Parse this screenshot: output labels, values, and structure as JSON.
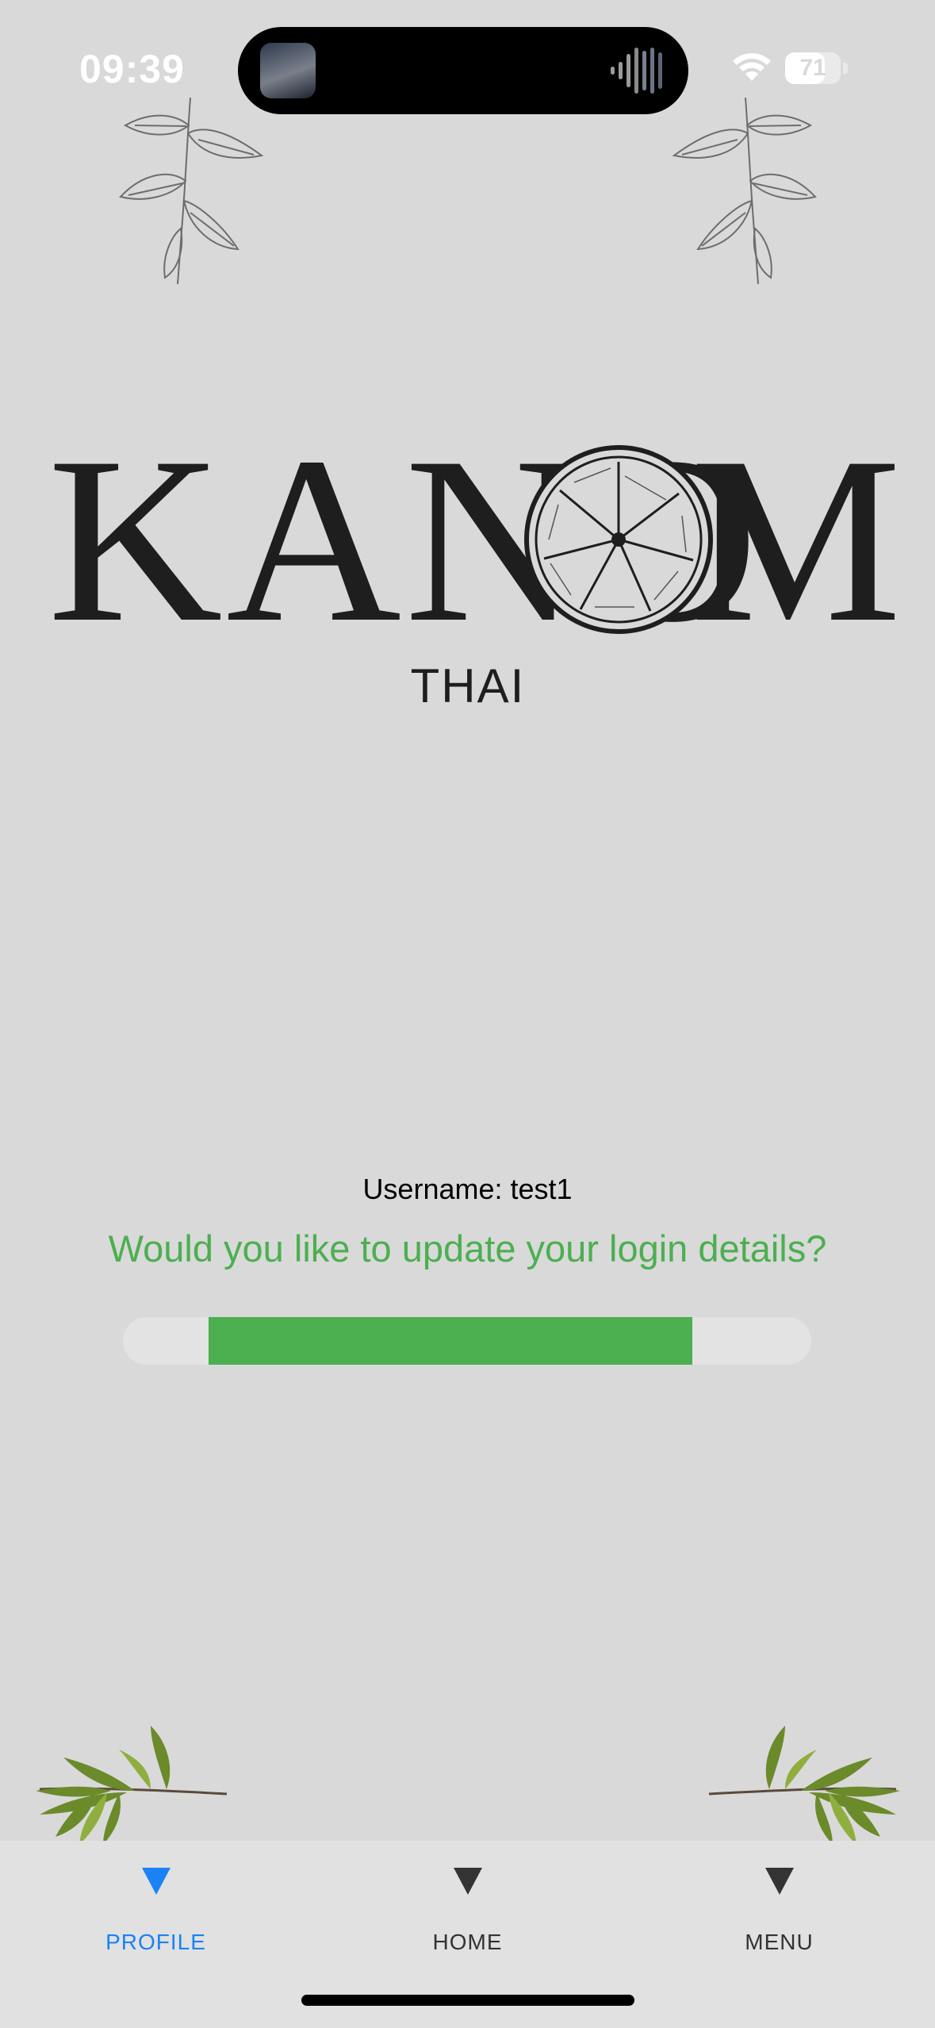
{
  "status_bar": {
    "time": "09:39",
    "battery_level": "71",
    "battery_percent": 71,
    "icons": [
      "now-playing-artwork-icon",
      "audio-waveform-icon",
      "wifi-icon",
      "battery-icon"
    ]
  },
  "logo": {
    "word_start": "KANO",
    "word_end": "M",
    "subtitle": "THAI",
    "graphic": "lime-slice-icon"
  },
  "profile": {
    "username_text": "Username: test1",
    "update_prompt": "Would you like to update your login details?",
    "progress_fraction": 0.75
  },
  "decorations": [
    "sketch-branch-left-icon",
    "sketch-branch-right-icon",
    "leaf-sprig-left-icon",
    "leaf-sprig-right-icon"
  ],
  "tab_bar": {
    "tabs": [
      {
        "label": "PROFILE",
        "active": true,
        "icon": "triangle-down-icon"
      },
      {
        "label": "HOME",
        "active": false,
        "icon": "triangle-down-icon"
      },
      {
        "label": "MENU",
        "active": false,
        "icon": "triangle-down-icon"
      }
    ]
  },
  "colors": {
    "background": "#d9d9d9",
    "accent_green": "#4caf50",
    "active_tab": "#1a82f5",
    "inactive_tab": "#333333"
  }
}
